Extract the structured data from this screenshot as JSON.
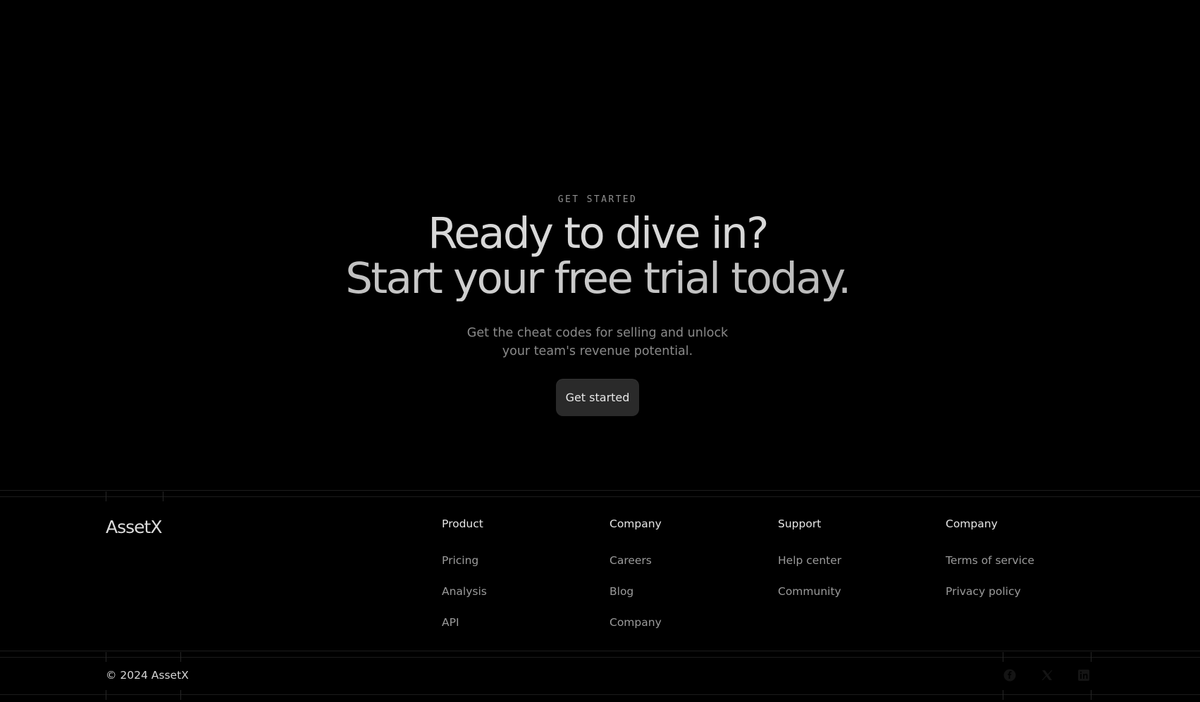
{
  "hero": {
    "eyebrow": "GET STARTED",
    "headline_line1": "Ready to dive in?",
    "headline_line2": "Start your free trial today.",
    "subtitle_line1": "Get the cheat codes for selling and unlock",
    "subtitle_line2": "your team's revenue potential.",
    "cta_label": "Get started"
  },
  "footer": {
    "logo": "AssetX",
    "columns": [
      {
        "title": "Product",
        "links": [
          "Pricing",
          "Analysis",
          "API"
        ]
      },
      {
        "title": "Company",
        "links": [
          "Careers",
          "Blog",
          "Company"
        ]
      },
      {
        "title": "Support",
        "links": [
          "Help center",
          "Community"
        ]
      },
      {
        "title": "Company",
        "links": [
          "Terms of service",
          "Privacy policy"
        ]
      }
    ],
    "copyright": "© 2024 AssetX",
    "social_icons": [
      "facebook-icon",
      "x-icon",
      "linkedin-icon"
    ]
  },
  "colors": {
    "background": "#000000",
    "button_bg": "#2a2a2a",
    "muted_text": "#8a8a8a",
    "link_text": "#9b9b9b"
  }
}
